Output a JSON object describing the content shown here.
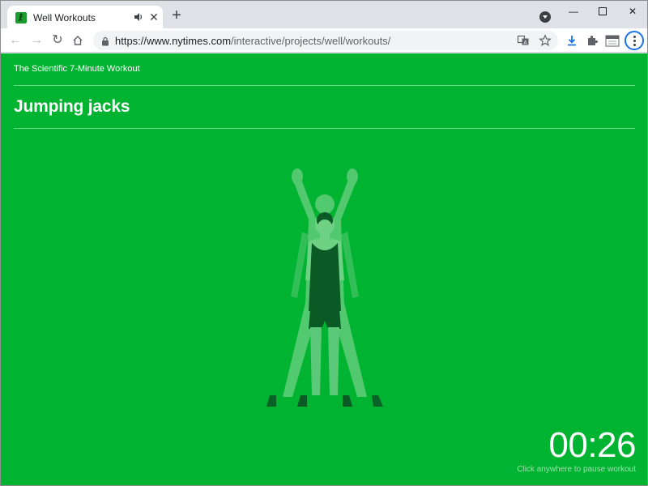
{
  "browser": {
    "tab": {
      "title": "Well Workouts"
    },
    "address": {
      "scheme_host": "https://www.nytimes.com",
      "path": "/interactive/projects/well/workouts/"
    }
  },
  "page": {
    "kicker": "The Scientific 7-Minute Workout",
    "exercise_title": "Jumping jacks",
    "timer": "00:26",
    "hint": "Click anywhere to pause workout"
  },
  "icons": {
    "tab_favicon": "runner-icon",
    "tab_audio": "speaker-icon",
    "translate": "translate-icon",
    "bookmark": "star-icon",
    "download": "download-icon",
    "extensions": "puzzle-icon",
    "menu": "kebab-menu-icon"
  },
  "colors": {
    "page_background": "#00b330",
    "figure_dark": "#0b5a26",
    "figure_light": "#6ed184"
  }
}
